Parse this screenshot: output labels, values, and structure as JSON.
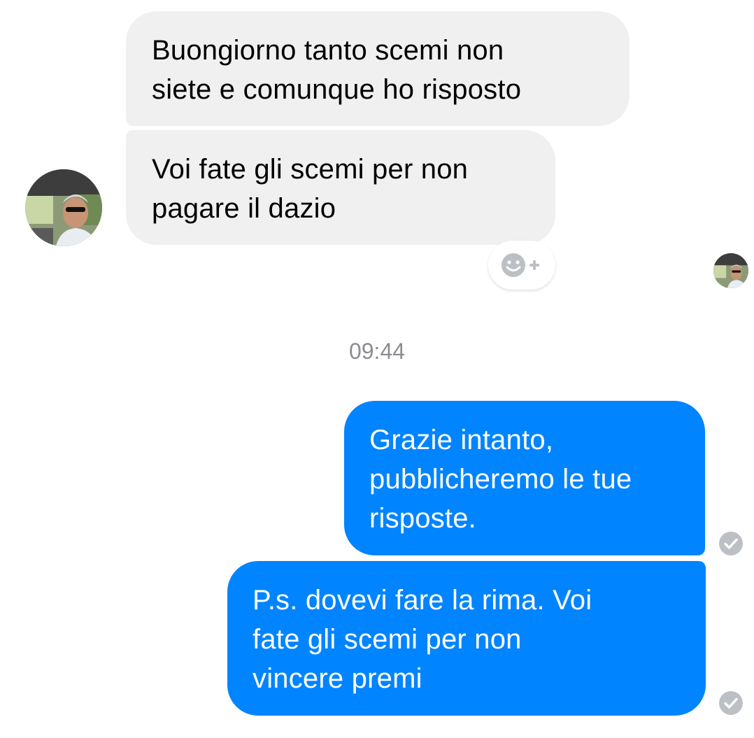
{
  "conversation": {
    "incoming": [
      {
        "lines": [
          "Buongiorno tanto scemi non",
          "siete e comunque ho risposto"
        ]
      },
      {
        "lines": [
          "Voi fate gli scemi per non",
          "pagare il dazio"
        ]
      }
    ],
    "reaction_icon": "smiley-plus-icon",
    "timestamp": "09:44",
    "outgoing": [
      {
        "lines": [
          "Grazie intanto,",
          "pubblicheremo le tue",
          "risposte."
        ],
        "status": "delivered"
      },
      {
        "lines": [
          "P.s. dovevi fare la rima. Voi",
          "fate gli scemi per non",
          "vincere premi"
        ],
        "status": "delivered"
      }
    ]
  },
  "colors": {
    "incoming_bubble": "#f1f0f0",
    "outgoing_bubble": "#0084ff",
    "timestamp_text": "#8a8d91",
    "check_icon": "#bcc0c4"
  }
}
